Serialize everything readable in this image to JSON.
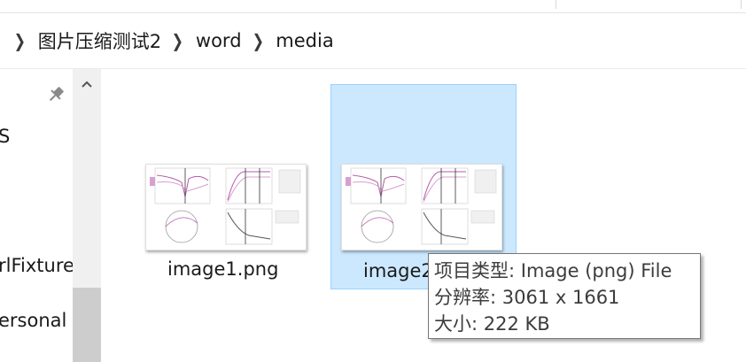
{
  "breadcrumb": {
    "items": [
      "图片压缩测试2",
      "word",
      "media"
    ]
  },
  "nav": {
    "items": [
      "S",
      "rlFixture",
      "ersonal"
    ]
  },
  "files": [
    {
      "name": "image1.png"
    },
    {
      "name": "image2.png"
    }
  ],
  "tooltip": {
    "type": "项目类型: Image (png) File",
    "resolution": "分辨率: 3061 x 1661",
    "size": "大小: 222 KB"
  },
  "colors": {
    "selection": "#cce8ff",
    "selection_border": "#99d1ff"
  }
}
